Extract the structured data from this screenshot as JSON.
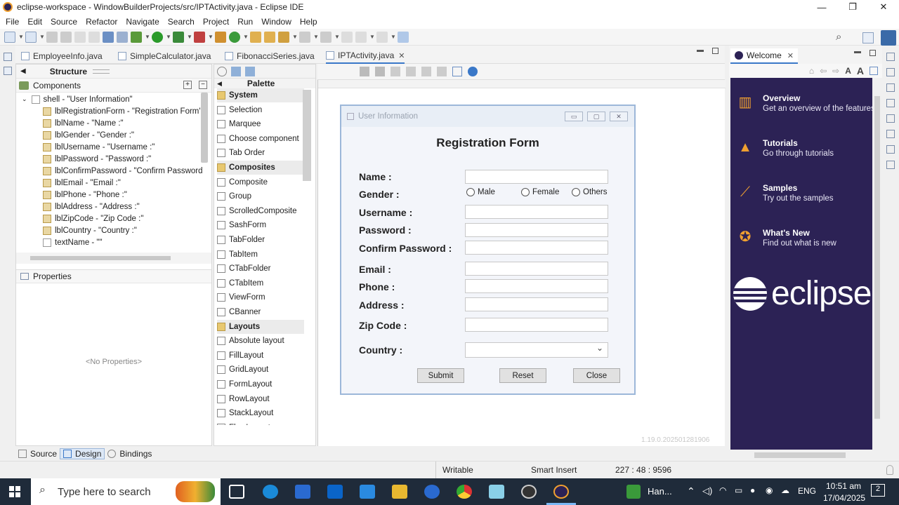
{
  "window": {
    "title": "eclipse-workspace - WindowBuilderProjects/src/IPTActivity.java - Eclipse IDE",
    "minimize": "—",
    "restore": "❐",
    "close": "✕"
  },
  "menu": [
    "File",
    "Edit",
    "Source",
    "Refactor",
    "Navigate",
    "Search",
    "Project",
    "Run",
    "Window",
    "Help"
  ],
  "editor_tabs": [
    {
      "label": "EmployeeInfo.java"
    },
    {
      "label": "SimpleCalculator.java"
    },
    {
      "label": "FibonacciSeries.java"
    },
    {
      "label": "IPTActivity.java",
      "active": true,
      "close": "✕"
    }
  ],
  "structure": {
    "title": "Structure",
    "components_label": "Components",
    "tree": [
      "shell - \"User Information\"",
      "lblRegistrationForm - \"Registration Form\"",
      "lblName - \"Name :\"",
      "lblGender - \"Gender :\"",
      "lblUsername - \"Username :\"",
      "lblPassword - \"Password :\"",
      "lblConfirmPassword - \"Confirm Password",
      "lblEmail - \"Email :\"",
      "lblPhone - \"Phone :\"",
      "lblAddress - \"Address :\"",
      "lblZipCode - \"Zip Code :\"",
      "lblCountry - \"Country :\"",
      "textName - \"\""
    ],
    "properties_label": "Properties",
    "no_properties": "<No Properties>"
  },
  "palette": {
    "title": "Palette",
    "items": [
      {
        "label": "System",
        "category": true
      },
      {
        "label": "Selection"
      },
      {
        "label": "Marquee"
      },
      {
        "label": "Choose component"
      },
      {
        "label": "Tab Order"
      },
      {
        "label": "Composites",
        "category": true
      },
      {
        "label": "Composite"
      },
      {
        "label": "Group"
      },
      {
        "label": "ScrolledComposite"
      },
      {
        "label": "SashForm"
      },
      {
        "label": "TabFolder"
      },
      {
        "label": "TabItem"
      },
      {
        "label": "CTabFolder"
      },
      {
        "label": "CTabItem"
      },
      {
        "label": "ViewForm"
      },
      {
        "label": "CBanner"
      },
      {
        "label": "Layouts",
        "category": true
      },
      {
        "label": "Absolute layout"
      },
      {
        "label": "FillLayout"
      },
      {
        "label": "GridLayout"
      },
      {
        "label": "FormLayout"
      },
      {
        "label": "RowLayout"
      },
      {
        "label": "StackLayout"
      },
      {
        "label": "FlowLayout"
      }
    ]
  },
  "form": {
    "window_title": "User Information",
    "heading": "Registration Form",
    "labels": {
      "name": "Name :",
      "gender": "Gender :",
      "username": "Username :",
      "password": "Password :",
      "confirm": "Confirm Password :",
      "email": "Email :",
      "phone": "Phone :",
      "address": "Address :",
      "zip": "Zip Code :",
      "country": "Country :"
    },
    "gender_options": [
      "Male",
      "Female",
      "Others"
    ],
    "buttons": {
      "submit": "Submit",
      "reset": "Reset",
      "close": "Close"
    },
    "dropdown_arrow": "⌄"
  },
  "welcome": {
    "tab": "Welcome",
    "items": [
      {
        "title": "Overview",
        "desc": "Get an overview of the features",
        "icon": "book-icon"
      },
      {
        "title": "Tutorials",
        "desc": "Go through tutorials",
        "icon": "grad-cap-icon"
      },
      {
        "title": "Samples",
        "desc": "Try out the samples",
        "icon": "wand-icon"
      },
      {
        "title": "What's New",
        "desc": "Find out what is new",
        "icon": "star-icon"
      }
    ],
    "logo_text": "eclipse"
  },
  "version": "1.19.0.202501281906",
  "bottom_tabs": [
    "Source",
    "Design",
    "Bindings"
  ],
  "status": {
    "writable": "Writable",
    "insert": "Smart Insert",
    "position": "227 : 48 : 9596"
  },
  "taskbar": {
    "search_placeholder": "Type here to search",
    "weather": "Han...",
    "lang": "ENG",
    "time": "10:51 am",
    "date": "17/04/2025",
    "notifications": "2"
  },
  "colors": {
    "welcome_bg": "#2c2255",
    "accent_orange": "#f0a030",
    "taskbar": "#1f2b3a"
  }
}
